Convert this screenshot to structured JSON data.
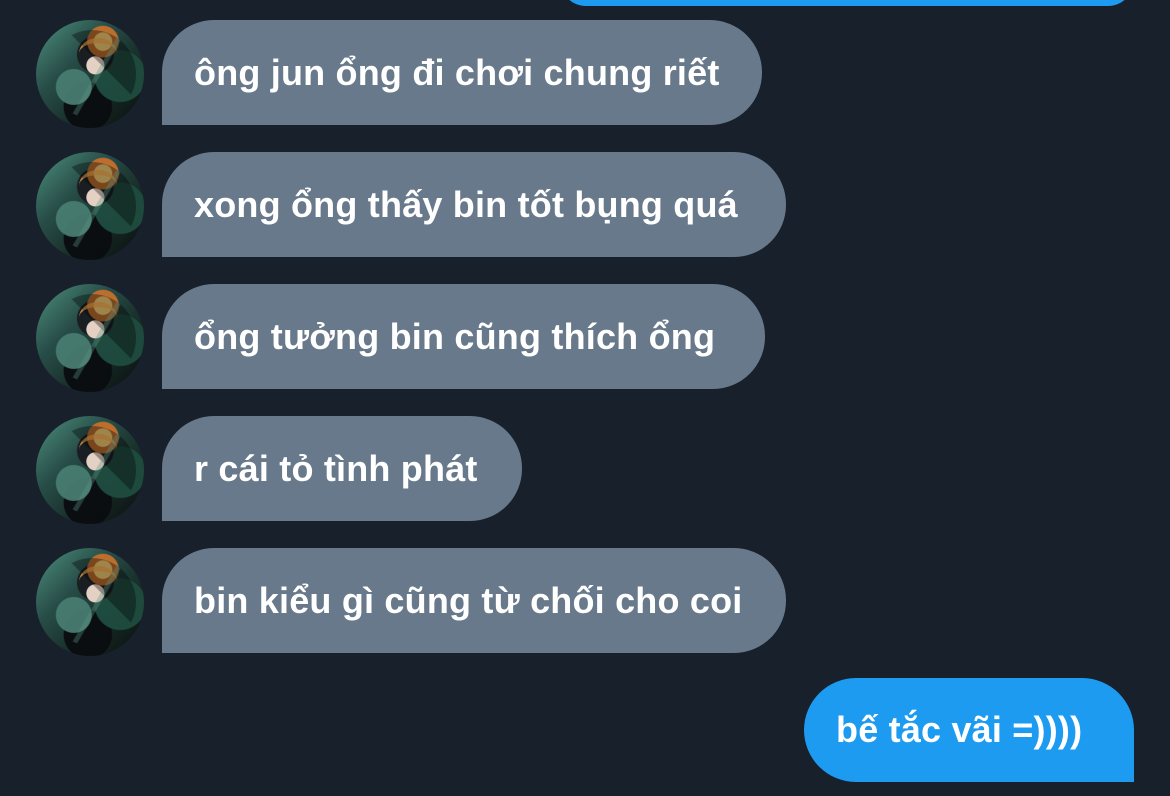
{
  "thread": {
    "messages": [
      {
        "direction": "received",
        "text": "ông jun ổng đi chơi chung riết",
        "avatar": "profile-avatar"
      },
      {
        "direction": "received",
        "text": "xong ổng thấy bin tốt bụng quá",
        "avatar": "profile-avatar"
      },
      {
        "direction": "received",
        "text": "ổng tưởng bin cũng thích ổng",
        "avatar": "profile-avatar"
      },
      {
        "direction": "received",
        "text": "r cái tỏ tình phát",
        "avatar": "profile-avatar"
      },
      {
        "direction": "received",
        "text": "bin kiểu gì cũng từ chối cho coi",
        "avatar": "profile-avatar"
      },
      {
        "direction": "sent",
        "text": "bế tắc vãi =))))"
      }
    ]
  },
  "theme": {
    "background": "#18202b",
    "received_bubble": "#67798a",
    "sent_bubble": "#1d9bf0",
    "text": "#ffffff"
  }
}
